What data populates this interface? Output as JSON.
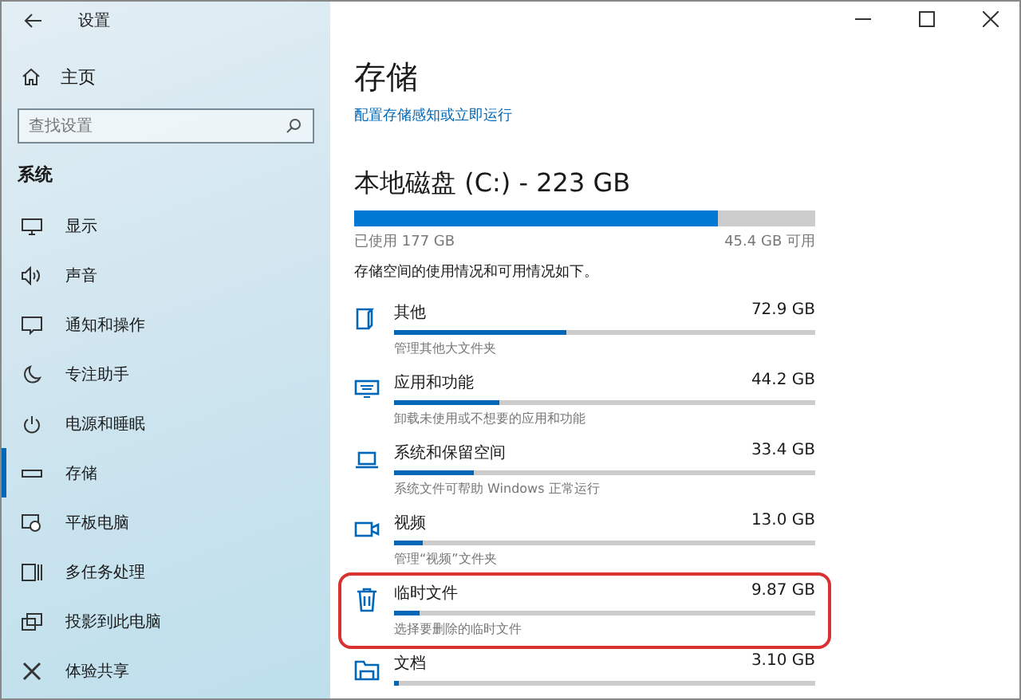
{
  "window": {
    "title": "设置"
  },
  "sidebar": {
    "home": "主页",
    "search": {
      "placeholder": "查找设置"
    },
    "section": "系统",
    "items": [
      {
        "label": "显示",
        "selected": false
      },
      {
        "label": "声音",
        "selected": false
      },
      {
        "label": "通知和操作",
        "selected": false
      },
      {
        "label": "专注助手",
        "selected": false
      },
      {
        "label": "电源和睡眠",
        "selected": false
      },
      {
        "label": "存储",
        "selected": true
      },
      {
        "label": "平板电脑",
        "selected": false
      },
      {
        "label": "多任务处理",
        "selected": false
      },
      {
        "label": "投影到此电脑",
        "selected": false
      },
      {
        "label": "体验共享",
        "selected": false
      }
    ]
  },
  "main": {
    "title": "存储",
    "link": "配置存储感知或立即运行",
    "disk": {
      "title": "本地磁盘 (C:) - 223 GB",
      "level": 0.79,
      "used": "已使用 177 GB",
      "free": "45.4 GB 可用"
    },
    "description": "存储空间的使用情况和可用情况如下。",
    "categories": [
      {
        "name": "其他",
        "size": "72.9 GB",
        "level": 0.41,
        "subtitle": "管理其他大文件夹",
        "highlighted": false
      },
      {
        "name": "应用和功能",
        "size": "44.2 GB",
        "level": 0.25,
        "subtitle": "卸载未使用或不想要的应用和功能",
        "highlighted": false
      },
      {
        "name": "系统和保留空间",
        "size": "33.4 GB",
        "level": 0.19,
        "subtitle": "系统文件可帮助 Windows 正常运行",
        "highlighted": false
      },
      {
        "name": "视频",
        "size": "13.0 GB",
        "level": 0.07,
        "subtitle": "管理“视频”文件夹",
        "highlighted": false
      },
      {
        "name": "临时文件",
        "size": "9.87 GB",
        "level": 0.06,
        "subtitle": "选择要删除的临时文件",
        "highlighted": true
      },
      {
        "name": "文档",
        "size": "3.10 GB",
        "level": 0.01,
        "highlighted": false
      }
    ]
  }
}
